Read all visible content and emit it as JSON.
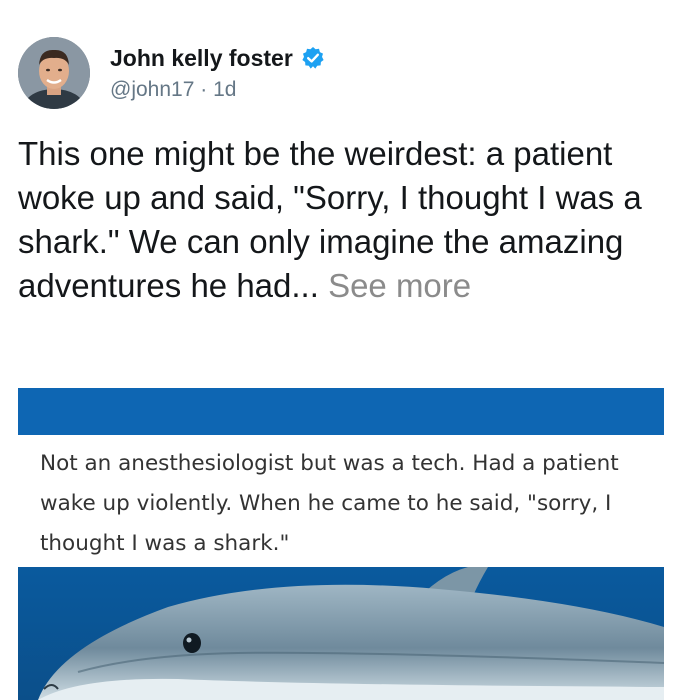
{
  "post": {
    "author_name": "John kelly foster",
    "handle": "@john17",
    "separator": "·",
    "age": "1d",
    "text": "This one might be the weirdest: a patient woke up and said, \"Sorry, I thought I was a shark.\" We can only imagine the amazing adventures he had...",
    "see_more": "See more"
  },
  "card": {
    "quote": "Not an anesthesiologist but was a tech. Had a patient wake up violently. When he came to he said, \"sorry, I thought I was a shark.\""
  },
  "icons": {
    "verified": "verified-badge-icon"
  },
  "colors": {
    "verified_blue": "#1da1f2",
    "card_blue": "#0e66b3"
  }
}
